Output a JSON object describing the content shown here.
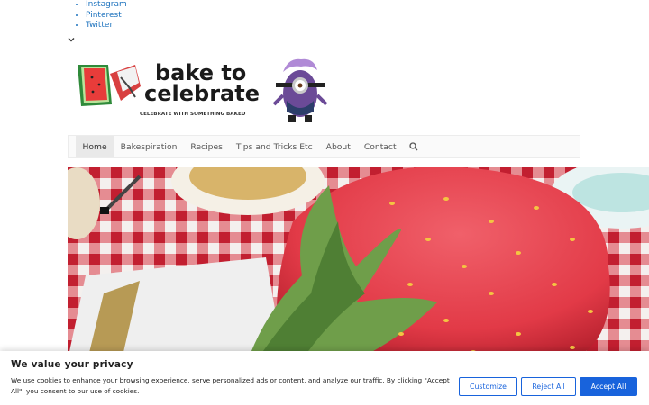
{
  "social_links": [
    "Instagram",
    "Pinterest",
    "Twitter"
  ],
  "site": {
    "logo_line1": "bake to",
    "logo_line2": "celebrate",
    "tagline": "CELEBRATE WITH SOMETHING BAKED"
  },
  "nav": {
    "items": [
      "Home",
      "Bakespiration",
      "Recipes",
      "Tips and Tricks Etc",
      "About",
      "Contact"
    ],
    "active": "Home",
    "search_icon": "search-icon"
  },
  "cookie": {
    "title": "We value your privacy",
    "text": "We use cookies to enhance your browsing experience, serve personalized ads or content, and analyze our traffic. By clicking \"Accept All\", you consent to our use of cookies.",
    "customize": "Customize",
    "reject": "Reject All",
    "accept": "Accept All"
  },
  "colors": {
    "link": "#1e73be",
    "accent_button": "#1863dc",
    "minion_purple": "#6b4a97",
    "strawberry_red": "#e64450"
  }
}
